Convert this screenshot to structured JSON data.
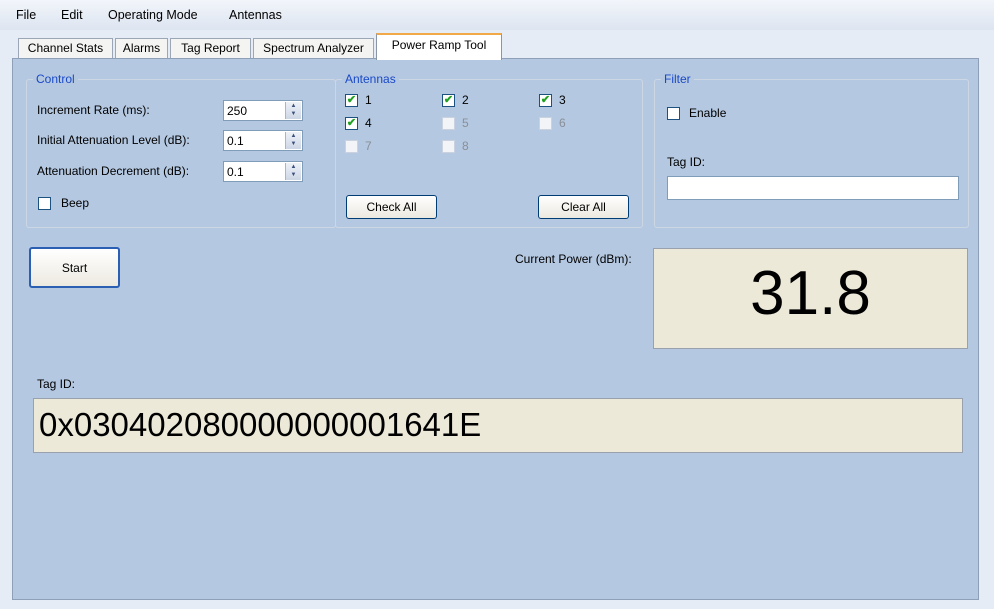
{
  "menu": {
    "file": "File",
    "edit": "Edit",
    "operating_mode": "Operating Mode",
    "antennas": "Antennas"
  },
  "tabs": [
    "Channel Stats",
    "Alarms",
    "Tag Report",
    "Spectrum Analyzer",
    "Power Ramp Tool"
  ],
  "active_tab": "Power Ramp Tool",
  "control": {
    "title": "Control",
    "increment_rate_label": "Increment Rate (ms):",
    "increment_rate_value": "250",
    "initial_atten_label": "Initial Attenuation Level (dB):",
    "initial_atten_value": "0.1",
    "atten_decrement_label": "Attenuation Decrement (dB):",
    "atten_decrement_value": "0.1",
    "beep_label": "Beep",
    "beep_checked": false
  },
  "antennas": {
    "title": "Antennas",
    "items": [
      {
        "label": "1",
        "checked": true,
        "enabled": true
      },
      {
        "label": "2",
        "checked": true,
        "enabled": true
      },
      {
        "label": "3",
        "checked": true,
        "enabled": true
      },
      {
        "label": "4",
        "checked": true,
        "enabled": true
      },
      {
        "label": "5",
        "checked": false,
        "enabled": false
      },
      {
        "label": "6",
        "checked": false,
        "enabled": false
      },
      {
        "label": "7",
        "checked": false,
        "enabled": false
      },
      {
        "label": "8",
        "checked": false,
        "enabled": false
      }
    ],
    "check_all": "Check All",
    "clear_all": "Clear All"
  },
  "filter": {
    "title": "Filter",
    "enable_label": "Enable",
    "enable_checked": false,
    "tag_id_label": "Tag ID:",
    "tag_id_value": ""
  },
  "start_label": "Start",
  "current_power_label": "Current Power (dBm):",
  "current_power_value": "31.8",
  "tag_id_label": "Tag ID:",
  "tag_id_value": "0x030402080000000001641E",
  "colors": {
    "group_title": "#1a49c8",
    "panel_bg": "#b4c8e1",
    "display_bg": "#ece9d8",
    "check_green": "#21a121"
  }
}
